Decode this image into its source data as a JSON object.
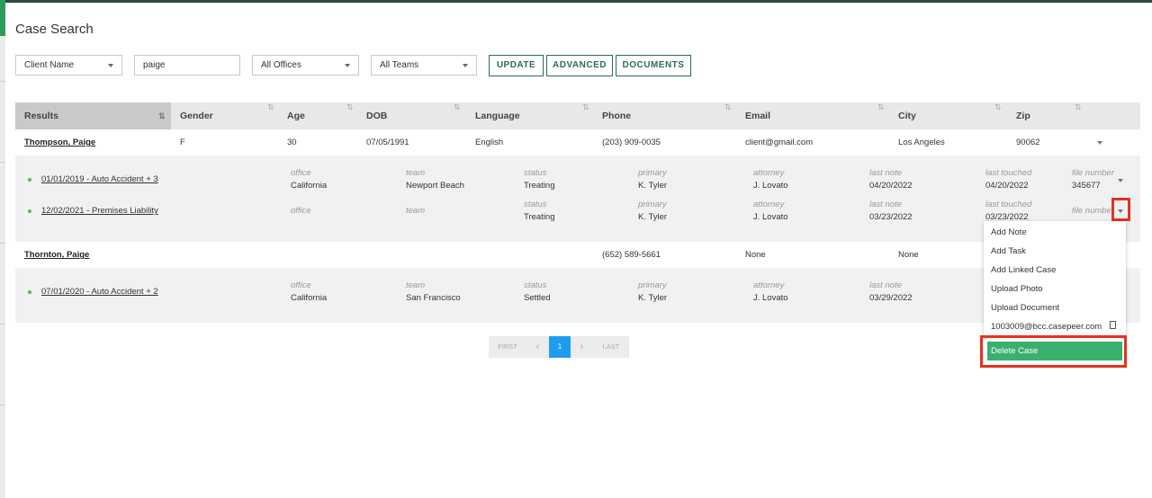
{
  "page": {
    "title": "Case Search"
  },
  "filters": {
    "search_by": "Client Name",
    "query": "paige",
    "offices": "All Offices",
    "teams": "All Teams",
    "update_label": "UPDATE",
    "advanced_label": "ADVANCED",
    "documents_label": "DOCUMENTS"
  },
  "table": {
    "columns": [
      "Results",
      "Gender",
      "Age",
      "DOB",
      "Language",
      "Phone",
      "Email",
      "City",
      "Zip"
    ],
    "clients": [
      {
        "name": "Thompson, Paige",
        "gender": "F",
        "age": "30",
        "dob": "07/05/1991",
        "language": "English",
        "phone": "(203) 909-0035",
        "email": "client@gmail.com",
        "city": "Los Angeles",
        "zip": "90062",
        "cases": [
          {
            "title": "01/01/2019 - Auto Accident + 3",
            "office_label": "office",
            "office": "California",
            "team_label": "team",
            "team": "Newport Beach",
            "status_label": "status",
            "status": "Treating",
            "primary_label": "primary",
            "primary": "K. Tyler",
            "attorney_label": "attorney",
            "attorney": "J. Lovato",
            "last_note_label": "last note",
            "last_note": "04/20/2022",
            "last_touched_label": "last touched",
            "last_touched": "04/20/2022",
            "file_number_label": "file number",
            "file_number": "345677"
          },
          {
            "title": "12/02/2021 - Premises Liability",
            "office_label": "office",
            "office": "",
            "team_label": "team",
            "team": "",
            "status_label": "status",
            "status": "Treating",
            "primary_label": "primary",
            "primary": "K. Tyler",
            "attorney_label": "attorney",
            "attorney": "J. Lovato",
            "last_note_label": "last note",
            "last_note": "03/23/2022",
            "last_touched_label": "last touched",
            "last_touched": "03/23/2022",
            "file_number_label": "file number",
            "file_number": ""
          }
        ]
      },
      {
        "name": "Thornton, Paige",
        "phone": "(652) 589-5661",
        "email": "None",
        "city": "None",
        "cases": [
          {
            "title": "07/01/2020 - Auto Accident + 2",
            "office_label": "office",
            "office": "California",
            "team_label": "team",
            "team": "San Francisco",
            "status_label": "status",
            "status": "Settled",
            "primary_label": "primary",
            "primary": "K. Tyler",
            "attorney_label": "attorney",
            "attorney": "J. Lovato",
            "last_note_label": "last note",
            "last_note": "03/29/2022"
          }
        ]
      }
    ]
  },
  "context_menu": {
    "items": [
      "Add Note",
      "Add Task",
      "Add Linked Case",
      "Upload Photo",
      "Upload Document",
      "1003009@bcc.casepeer.com"
    ],
    "delete_label": "Delete Case"
  },
  "pagination": {
    "first": "FIRST",
    "prev": "‹",
    "current": "1",
    "next": "›",
    "last": "LAST"
  },
  "colors": {
    "accent": "#2a6e55",
    "delete": "#3ab06e",
    "highlight": "#e4321e",
    "page_active": "#1e9df0"
  }
}
